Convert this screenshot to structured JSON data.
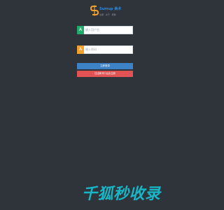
{
  "header": {
    "logo_text": "Sumup 美术",
    "logo_sub": "注册 · 关于 · 帮助"
  },
  "form": {
    "username": {
      "icon_letter": "A",
      "icon_color": "#22a96b",
      "placeholder": "输入用户名",
      "value": ""
    },
    "password": {
      "icon_letter": "A",
      "icon_color": "#f2a12d",
      "placeholder": "输入密码",
      "value": ""
    },
    "login_label": "立即登录",
    "register_label": "还没帐号?点此注册"
  },
  "colors": {
    "background": "#2f343b",
    "login_button": "#3d82c7",
    "register_button": "#e05253",
    "brand": "#17b7c7"
  },
  "footer": {
    "brand_text": "千狐秒收录"
  }
}
